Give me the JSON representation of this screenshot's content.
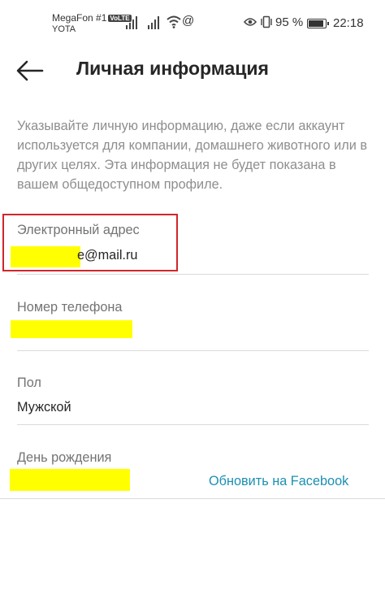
{
  "status_bar": {
    "carrier_primary": "MegaFon #1",
    "volte_badge": "VoLTE",
    "carrier_secondary": "YOTA",
    "at_symbol": "@",
    "battery_percent": "95 %",
    "time": "22:18",
    "icons": [
      "signal-icon",
      "signal-icon",
      "wifi-icon",
      "at-icon",
      "eye-icon",
      "vibrate-icon",
      "battery-icon"
    ]
  },
  "header": {
    "title": "Личная информация",
    "back_icon": "back-arrow-icon"
  },
  "description": "Указывайте личную информацию, даже если аккаунт используется для компании, домашнего животного или в других целях. Эта информация не будет показана в вашем общедоступном профиле.",
  "fields": {
    "email": {
      "label": "Электронный адрес",
      "value": "e@mail.ru"
    },
    "phone": {
      "label": "Номер телефона",
      "value": ""
    },
    "gender": {
      "label": "Пол",
      "value": "Мужской"
    },
    "birthday": {
      "label": "День рождения",
      "value": ""
    }
  },
  "facebook_link": "Обновить на Facebook",
  "colors": {
    "redaction": "#ffff00",
    "highlight_border": "#d0262a",
    "link": "#1b8fb3"
  }
}
